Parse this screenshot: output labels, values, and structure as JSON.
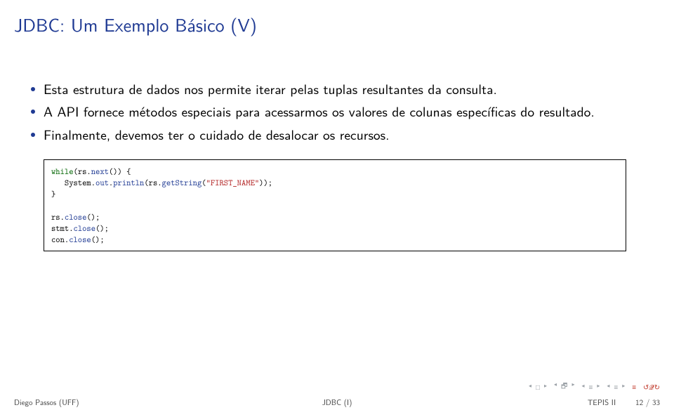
{
  "title": "JDBC: Um Exemplo Básico (V)",
  "bullets": [
    "Esta estrutura de dados nos permite iterar pelas tuplas resultantes da consulta.",
    "A API fornece métodos especiais para acessarmos os valores de colunas específicas do resultado.",
    "Finalmente, devemos ter o cuidado de desalocar os recursos."
  ],
  "code": {
    "tokens": [
      {
        "t": "while",
        "c": "kw"
      },
      {
        "t": "(rs.",
        "c": "plain"
      },
      {
        "t": "next",
        "c": "kw-blue"
      },
      {
        "t": "()) {",
        "c": "plain"
      },
      {
        "t": "\n",
        "c": "plain"
      },
      {
        "t": "   System.",
        "c": "plain"
      },
      {
        "t": "out",
        "c": "kw-blue"
      },
      {
        "t": ".",
        "c": "plain"
      },
      {
        "t": "println",
        "c": "kw-blue"
      },
      {
        "t": "(rs.",
        "c": "plain"
      },
      {
        "t": "getString",
        "c": "kw-blue"
      },
      {
        "t": "(",
        "c": "plain"
      },
      {
        "t": "\"FIRST_NAME\"",
        "c": "str"
      },
      {
        "t": "));",
        "c": "plain"
      },
      {
        "t": "\n",
        "c": "plain"
      },
      {
        "t": "}",
        "c": "plain"
      },
      {
        "t": "\n",
        "c": "plain"
      },
      {
        "t": "\n",
        "c": "plain"
      },
      {
        "t": "rs.",
        "c": "plain"
      },
      {
        "t": "close",
        "c": "kw-blue"
      },
      {
        "t": "();",
        "c": "plain"
      },
      {
        "t": "\n",
        "c": "plain"
      },
      {
        "t": "stmt.",
        "c": "plain"
      },
      {
        "t": "close",
        "c": "kw-blue"
      },
      {
        "t": "();",
        "c": "plain"
      },
      {
        "t": "\n",
        "c": "plain"
      },
      {
        "t": "con.",
        "c": "plain"
      },
      {
        "t": "close",
        "c": "kw-blue"
      },
      {
        "t": "();",
        "c": "plain"
      }
    ]
  },
  "footer": {
    "author": "Diego Passos (UFF)",
    "center": "JDBC (I)",
    "course": "TEPIS II",
    "page": "12 / 33"
  },
  "nav": {
    "first": "◂ □ ▸",
    "prev": "◂ 𝔇 ▸",
    "back": "◂ ≡ ▸",
    "fwd": "◂ ≡ ▸",
    "equiv": "≡",
    "reload": "↺𝓠↻"
  }
}
